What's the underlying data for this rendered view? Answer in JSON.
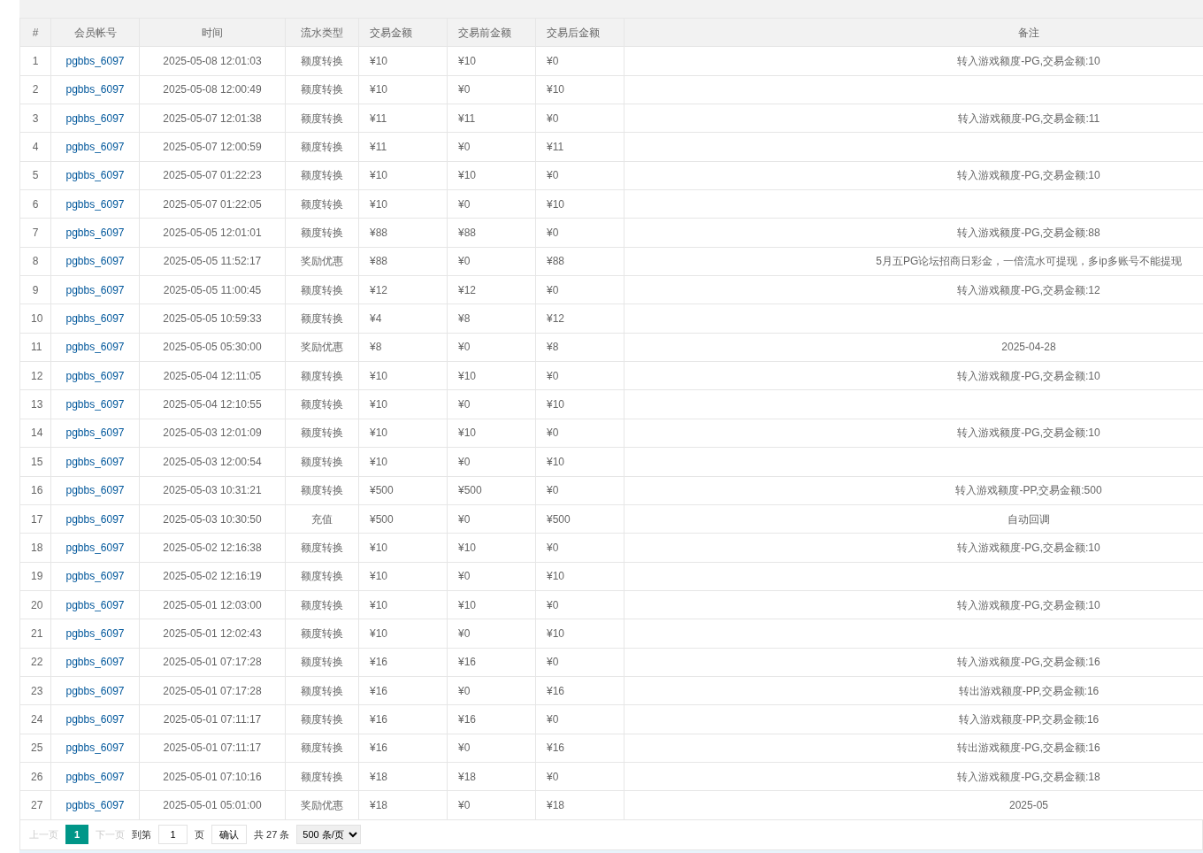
{
  "table": {
    "columns": [
      "#",
      "会员帐号",
      "时间",
      "流水类型",
      "交易金额",
      "交易前金额",
      "交易后金额",
      "备注"
    ],
    "rows": [
      [
        "1",
        "pgbbs_6097",
        "2025-05-08 12:01:03",
        "额度转换",
        "¥10",
        "¥10",
        "¥0",
        "转入游戏额度-PG,交易金额:10"
      ],
      [
        "2",
        "pgbbs_6097",
        "2025-05-08 12:00:49",
        "额度转换",
        "¥10",
        "¥0",
        "¥10",
        ""
      ],
      [
        "3",
        "pgbbs_6097",
        "2025-05-07 12:01:38",
        "额度转换",
        "¥11",
        "¥11",
        "¥0",
        "转入游戏额度-PG,交易金额:11"
      ],
      [
        "4",
        "pgbbs_6097",
        "2025-05-07 12:00:59",
        "额度转换",
        "¥11",
        "¥0",
        "¥11",
        ""
      ],
      [
        "5",
        "pgbbs_6097",
        "2025-05-07 01:22:23",
        "额度转换",
        "¥10",
        "¥10",
        "¥0",
        "转入游戏额度-PG,交易金额:10"
      ],
      [
        "6",
        "pgbbs_6097",
        "2025-05-07 01:22:05",
        "额度转换",
        "¥10",
        "¥0",
        "¥10",
        ""
      ],
      [
        "7",
        "pgbbs_6097",
        "2025-05-05 12:01:01",
        "额度转换",
        "¥88",
        "¥88",
        "¥0",
        "转入游戏额度-PG,交易金额:88"
      ],
      [
        "8",
        "pgbbs_6097",
        "2025-05-05 11:52:17",
        "奖励优惠",
        "¥88",
        "¥0",
        "¥88",
        "5月五PG论坛招商日彩金，一倍流水可提现，多ip多账号不能提现"
      ],
      [
        "9",
        "pgbbs_6097",
        "2025-05-05 11:00:45",
        "额度转换",
        "¥12",
        "¥12",
        "¥0",
        "转入游戏额度-PG,交易金额:12"
      ],
      [
        "10",
        "pgbbs_6097",
        "2025-05-05 10:59:33",
        "额度转换",
        "¥4",
        "¥8",
        "¥12",
        ""
      ],
      [
        "11",
        "pgbbs_6097",
        "2025-05-05 05:30:00",
        "奖励优惠",
        "¥8",
        "¥0",
        "¥8",
        "2025-04-28"
      ],
      [
        "12",
        "pgbbs_6097",
        "2025-05-04 12:11:05",
        "额度转换",
        "¥10",
        "¥10",
        "¥0",
        "转入游戏额度-PG,交易金额:10"
      ],
      [
        "13",
        "pgbbs_6097",
        "2025-05-04 12:10:55",
        "额度转换",
        "¥10",
        "¥0",
        "¥10",
        ""
      ],
      [
        "14",
        "pgbbs_6097",
        "2025-05-03 12:01:09",
        "额度转换",
        "¥10",
        "¥10",
        "¥0",
        "转入游戏额度-PG,交易金额:10"
      ],
      [
        "15",
        "pgbbs_6097",
        "2025-05-03 12:00:54",
        "额度转换",
        "¥10",
        "¥0",
        "¥10",
        ""
      ],
      [
        "16",
        "pgbbs_6097",
        "2025-05-03 10:31:21",
        "额度转换",
        "¥500",
        "¥500",
        "¥0",
        "转入游戏额度-PP,交易金额:500"
      ],
      [
        "17",
        "pgbbs_6097",
        "2025-05-03 10:30:50",
        "充值",
        "¥500",
        "¥0",
        "¥500",
        "自动回调"
      ],
      [
        "18",
        "pgbbs_6097",
        "2025-05-02 12:16:38",
        "额度转换",
        "¥10",
        "¥10",
        "¥0",
        "转入游戏额度-PG,交易金额:10"
      ],
      [
        "19",
        "pgbbs_6097",
        "2025-05-02 12:16:19",
        "额度转换",
        "¥10",
        "¥0",
        "¥10",
        ""
      ],
      [
        "20",
        "pgbbs_6097",
        "2025-05-01 12:03:00",
        "额度转换",
        "¥10",
        "¥10",
        "¥0",
        "转入游戏额度-PG,交易金额:10"
      ],
      [
        "21",
        "pgbbs_6097",
        "2025-05-01 12:02:43",
        "额度转换",
        "¥10",
        "¥0",
        "¥10",
        ""
      ],
      [
        "22",
        "pgbbs_6097",
        "2025-05-01 07:17:28",
        "额度转换",
        "¥16",
        "¥16",
        "¥0",
        "转入游戏额度-PG,交易金额:16"
      ],
      [
        "23",
        "pgbbs_6097",
        "2025-05-01 07:17:28",
        "额度转换",
        "¥16",
        "¥0",
        "¥16",
        "转出游戏额度-PP,交易金额:16"
      ],
      [
        "24",
        "pgbbs_6097",
        "2025-05-01 07:11:17",
        "额度转换",
        "¥16",
        "¥16",
        "¥0",
        "转入游戏额度-PP,交易金额:16"
      ],
      [
        "25",
        "pgbbs_6097",
        "2025-05-01 07:11:17",
        "额度转换",
        "¥16",
        "¥0",
        "¥16",
        "转出游戏额度-PG,交易金额:16"
      ],
      [
        "26",
        "pgbbs_6097",
        "2025-05-01 07:10:16",
        "额度转换",
        "¥18",
        "¥18",
        "¥0",
        "转入游戏额度-PG,交易金额:18"
      ],
      [
        "27",
        "pgbbs_6097",
        "2025-05-01 05:01:00",
        "奖励优惠",
        "¥18",
        "¥0",
        "¥18",
        "2025-05"
      ]
    ]
  },
  "pagination": {
    "prev": {
      "label": "上一页",
      "disabled": true
    },
    "pages": [
      {
        "label": "1",
        "selected": true
      }
    ],
    "next": {
      "label": "下一页",
      "disabled": true
    },
    "goto_label": "到第",
    "goto_value": "1",
    "page_unit": "页",
    "confirm": "确认",
    "total": "共 27 条",
    "page_size": "500 条/页"
  }
}
